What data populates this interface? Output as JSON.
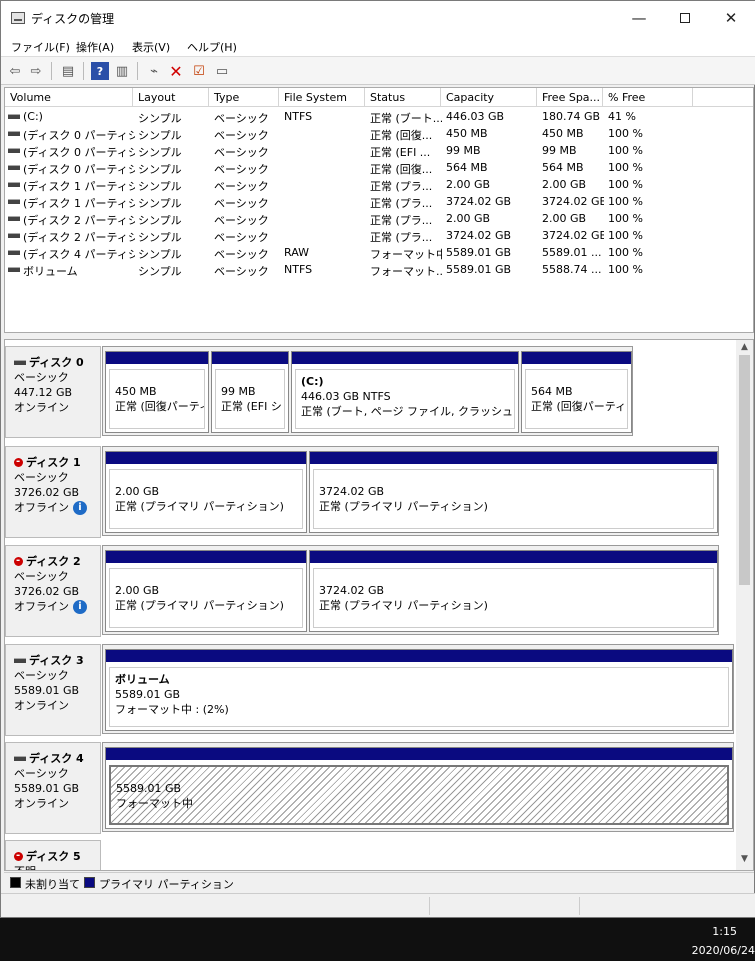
{
  "window": {
    "title": "ディスクの管理"
  },
  "menu": [
    "ファイル(F)",
    "操作(A)",
    "表示(V)",
    "ヘルプ(H)"
  ],
  "volume_list": {
    "columns": [
      "Volume",
      "Layout",
      "Type",
      "File System",
      "Status",
      "Capacity",
      "Free Spa...",
      "% Free"
    ],
    "rows": [
      [
        "(C:)",
        "シンプル",
        "ベーシック",
        "NTFS",
        "正常 (ブート...",
        "446.03 GB",
        "180.74 GB",
        "41 %"
      ],
      [
        "(ディスク 0 パーティシ...",
        "シンプル",
        "ベーシック",
        "",
        "正常 (回復...",
        "450 MB",
        "450 MB",
        "100 %"
      ],
      [
        "(ディスク 0 パーティシ...",
        "シンプル",
        "ベーシック",
        "",
        "正常 (EFI ...",
        "99 MB",
        "99 MB",
        "100 %"
      ],
      [
        "(ディスク 0 パーティシ...",
        "シンプル",
        "ベーシック",
        "",
        "正常 (回復...",
        "564 MB",
        "564 MB",
        "100 %"
      ],
      [
        "(ディスク 1 パーティシ...",
        "シンプル",
        "ベーシック",
        "",
        "正常 (プラ...",
        "2.00 GB",
        "2.00 GB",
        "100 %"
      ],
      [
        "(ディスク 1 パーティシ...",
        "シンプル",
        "ベーシック",
        "",
        "正常 (プラ...",
        "3724.02 GB",
        "3724.02 GB",
        "100 %"
      ],
      [
        "(ディスク 2 パーティシ...",
        "シンプル",
        "ベーシック",
        "",
        "正常 (プラ...",
        "2.00 GB",
        "2.00 GB",
        "100 %"
      ],
      [
        "(ディスク 2 パーティシ...",
        "シンプル",
        "ベーシック",
        "",
        "正常 (プラ...",
        "3724.02 GB",
        "3724.02 GB",
        "100 %"
      ],
      [
        "(ディスク 4 パーティシ...",
        "シンプル",
        "ベーシック",
        "RAW",
        "フォーマット中",
        "5589.01 GB",
        "5589.01 ...",
        "100 %"
      ],
      [
        "ボリューム",
        "シンプル",
        "ベーシック",
        "NTFS",
        "フォーマット...",
        "5589.01 GB",
        "5588.74 ...",
        "100 %"
      ]
    ]
  },
  "disks": [
    {
      "name": "ディスク 0",
      "type": "ベーシック",
      "size": "447.12 GB",
      "state": "オンライン",
      "offline": false,
      "partitions": [
        {
          "title": "",
          "line1": "450 MB",
          "line2": "正常 (回復パーティ"
        },
        {
          "title": "",
          "line1": "99 MB",
          "line2": "正常 (EFI シ"
        },
        {
          "title": "(C:)",
          "line1": "446.03 GB NTFS",
          "line2": "正常 (ブート, ページ ファイル, クラッシュ ダンプ, ."
        },
        {
          "title": "",
          "line1": "564 MB",
          "line2": "正常 (回復パーティシ"
        }
      ]
    },
    {
      "name": "ディスク 1",
      "type": "ベーシック",
      "size": "3726.02 GB",
      "state": "オフライン",
      "offline": true,
      "partitions": [
        {
          "title": "",
          "line1": "2.00 GB",
          "line2": "正常 (プライマリ パーティション)"
        },
        {
          "title": "",
          "line1": "3724.02 GB",
          "line2": "正常 (プライマリ パーティション)"
        }
      ]
    },
    {
      "name": "ディスク 2",
      "type": "ベーシック",
      "size": "3726.02 GB",
      "state": "オフライン",
      "offline": true,
      "partitions": [
        {
          "title": "",
          "line1": "2.00 GB",
          "line2": "正常 (プライマリ パーティション)"
        },
        {
          "title": "",
          "line1": "3724.02 GB",
          "line2": "正常 (プライマリ パーティション)"
        }
      ]
    },
    {
      "name": "ディスク 3",
      "type": "ベーシック",
      "size": "5589.01 GB",
      "state": "オンライン",
      "offline": false,
      "partitions": [
        {
          "title": "ボリューム",
          "line1": "5589.01 GB",
          "line2": "フォーマット中 : (2%)"
        }
      ]
    },
    {
      "name": "ディスク 4",
      "type": "ベーシック",
      "size": "5589.01 GB",
      "state": "オンライン",
      "offline": false,
      "partitions": [
        {
          "title": "",
          "line1": "5589.01 GB",
          "line2": "フォーマット中"
        }
      ]
    },
    {
      "name": "ディスク 5",
      "type": "不明",
      "size": "",
      "state": "",
      "offline": true,
      "partitions": []
    }
  ],
  "legend": [
    {
      "label": "未割り当て",
      "color": "#000000"
    },
    {
      "label": "プライマリ パーティション",
      "color": "#0a0a80"
    }
  ],
  "taskbar": {
    "time": "1:15",
    "date": "2020/06/24"
  }
}
